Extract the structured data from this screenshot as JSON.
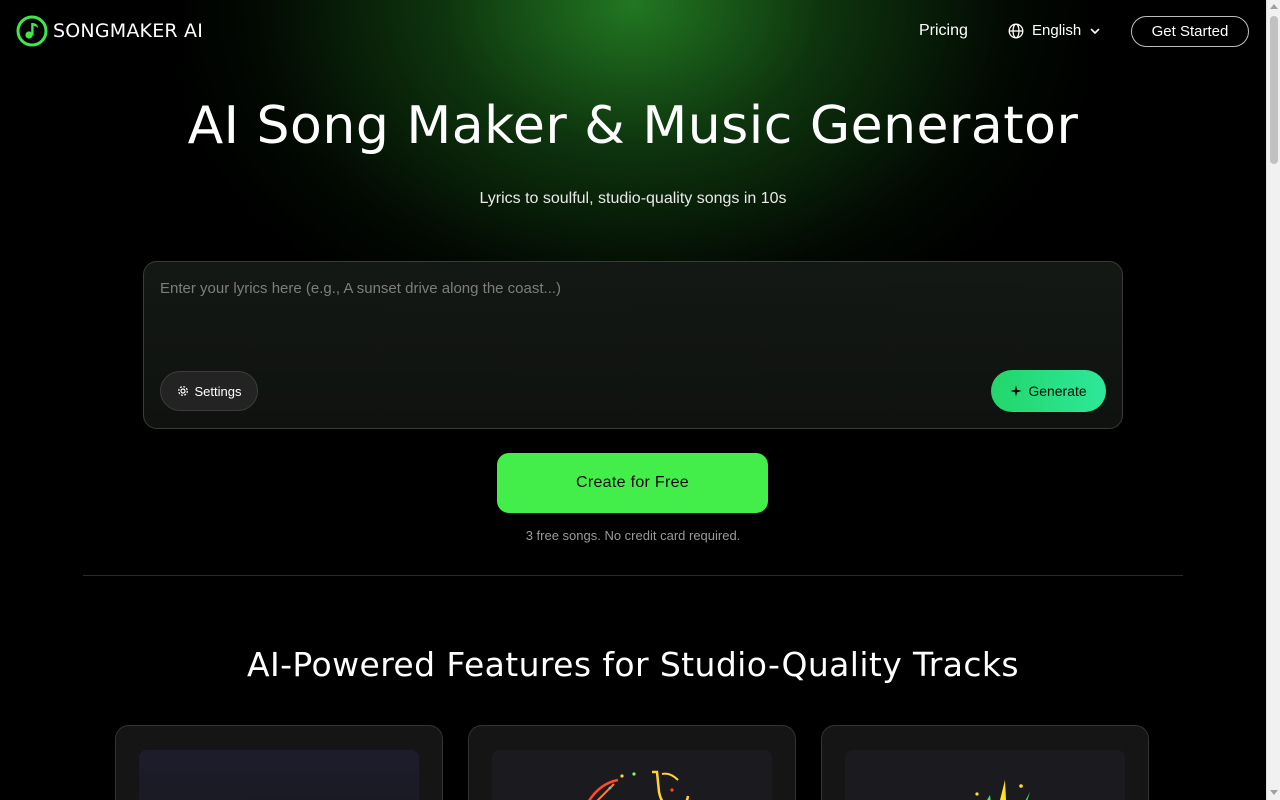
{
  "brand": {
    "name": "SONGMAKER AI",
    "accent": "#44ee4a"
  },
  "nav": {
    "pricing": "Pricing",
    "language": "English",
    "cta": "Get Started",
    "icons": {
      "language": "globe-icon",
      "dropdown": "chevron-down-icon"
    }
  },
  "hero": {
    "title": "AI Song Maker & Music Generator",
    "subtitle": "Lyrics to soulful, studio-quality songs in 10s"
  },
  "prompt": {
    "placeholder": "Enter your lyrics here (e.g., A sunset drive along the coast...)",
    "value": "",
    "settings_label": "Settings",
    "generate_label": "Generate",
    "icons": {
      "settings": "gear-icon",
      "generate": "sparkle-icon"
    }
  },
  "cta": {
    "label": "Create for Free",
    "note": "3 free songs. No credit card required."
  },
  "features": {
    "title": "AI-Powered Features for Studio-Quality Tracks"
  },
  "colors": {
    "background": "#000000",
    "generate_start": "#22d66a",
    "generate_end": "#2ee89a",
    "glow": "#288c28"
  }
}
